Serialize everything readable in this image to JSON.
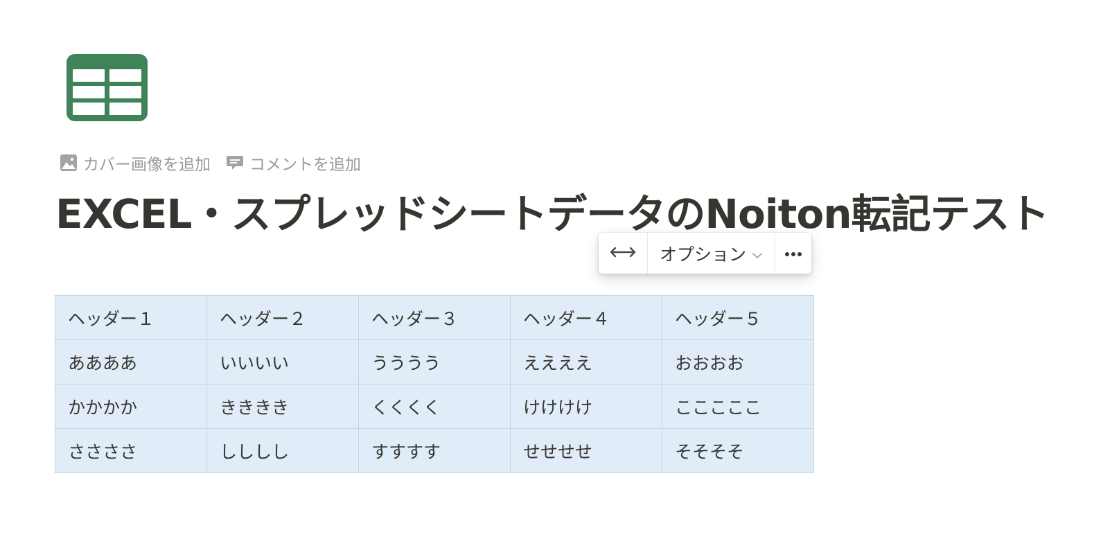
{
  "page": {
    "title": "EXCEL・スプレッドシートデータのNoiton転記テスト",
    "icon": "spreadsheet-icon",
    "icon_color": "#3f8359"
  },
  "controls": {
    "add_cover": {
      "label": "カバー画像を追加",
      "icon": "image-icon"
    },
    "add_comment": {
      "label": "コメントを追加",
      "icon": "comment-icon"
    }
  },
  "toolbar": {
    "width_icon": "arrows-horizontal-icon",
    "options_label": "オプション",
    "options_icon": "chevron-down-icon",
    "more_icon": "more-dots-icon"
  },
  "table": {
    "background": "#e1ecf9",
    "rows": [
      [
        "ヘッダー１",
        "ヘッダー２",
        "ヘッダー３",
        "ヘッダー４",
        "ヘッダー５"
      ],
      [
        "ああああ",
        "いいいい",
        "うううう",
        "ええええ",
        "おおおお"
      ],
      [
        "かかかか",
        "きききき",
        "くくくく",
        "けけけけ",
        "こここここ"
      ],
      [
        "ささささ",
        "しししし",
        "すすすす",
        "せせせせ",
        "そそそそ"
      ]
    ]
  }
}
